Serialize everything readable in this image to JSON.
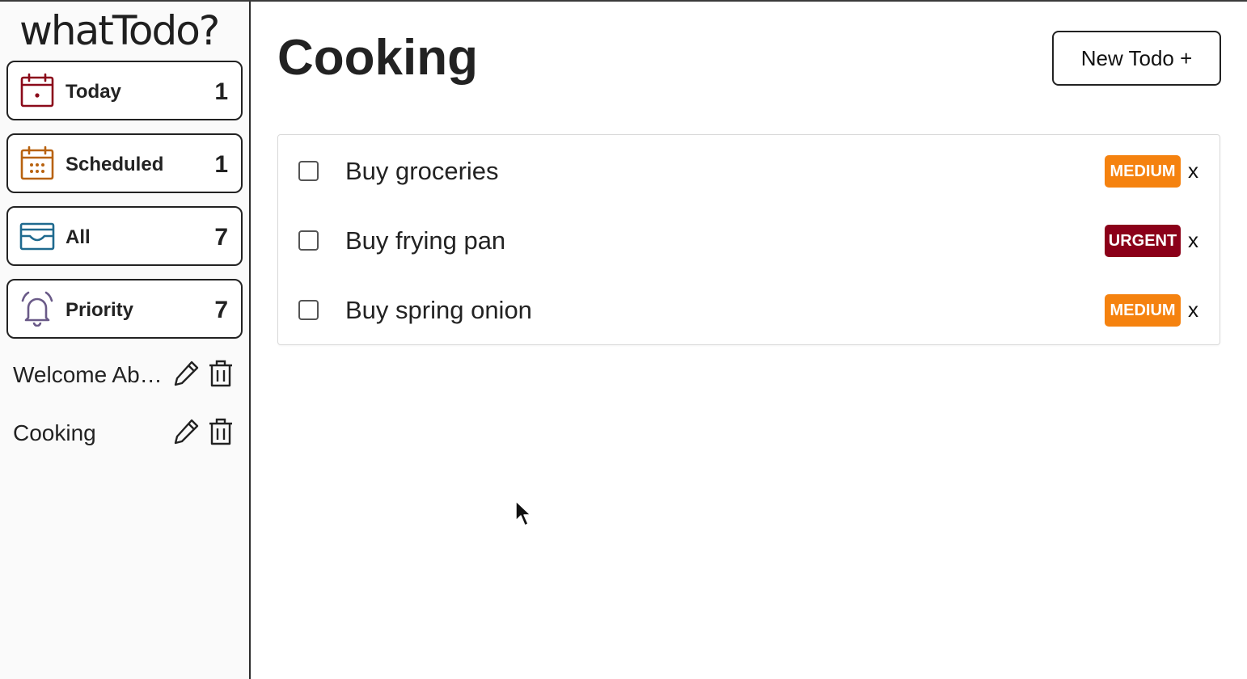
{
  "app": {
    "logo": "whatTodo?"
  },
  "sidebar": {
    "filters": [
      {
        "label": "Today",
        "count": "1",
        "icon": "calendar-day-icon",
        "color": "#8b0a1a"
      },
      {
        "label": "Scheduled",
        "count": "1",
        "icon": "calendar-grid-icon",
        "color": "#b8620f"
      },
      {
        "label": "All",
        "count": "7",
        "icon": "inbox-icon",
        "color": "#1f6a8f"
      },
      {
        "label": "Priority",
        "count": "7",
        "icon": "alarm-bell-icon",
        "color": "#6a5a88"
      }
    ],
    "projects": [
      {
        "name": "Welcome Aboard"
      },
      {
        "name": "Cooking"
      }
    ]
  },
  "main": {
    "title": "Cooking",
    "new_todo_label": "New Todo +",
    "todos": [
      {
        "text": "Buy groceries",
        "priority": "MEDIUM",
        "priority_color": "#f5820f",
        "done": false,
        "delete_label": "x"
      },
      {
        "text": "Buy frying pan",
        "priority": "URGENT",
        "priority_color": "#8b0019",
        "done": false,
        "delete_label": "x"
      },
      {
        "text": "Buy spring onion",
        "priority": "MEDIUM",
        "priority_color": "#f5820f",
        "done": false,
        "delete_label": "x"
      }
    ]
  }
}
